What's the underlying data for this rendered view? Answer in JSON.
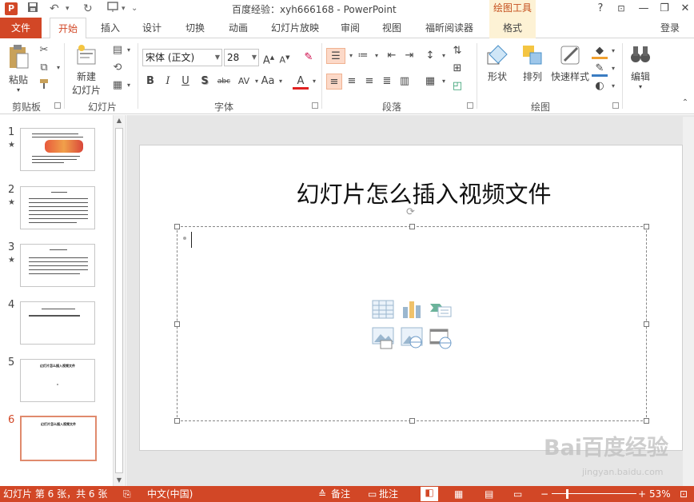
{
  "titlebar": {
    "app_icon": "P",
    "title": "百度经验：xyh666168 - PowerPoint",
    "context_tool": "绘图工具",
    "help": "?",
    "minimize": "—",
    "restore": "❐",
    "close": "✕"
  },
  "tabs": {
    "file": "文件",
    "items": [
      "开始",
      "插入",
      "设计",
      "切换",
      "动画",
      "幻灯片放映",
      "审阅",
      "视图",
      "福昕阅读器",
      "格式"
    ],
    "active": "开始",
    "login": "登录"
  },
  "ribbon": {
    "clipboard": {
      "label": "剪贴板",
      "paste": "粘贴"
    },
    "slides": {
      "label": "幻灯片",
      "new_slide_line1": "新建",
      "new_slide_line2": "幻灯片"
    },
    "font": {
      "label": "字体",
      "font_name": "宋体 (正文)",
      "font_size": "28",
      "bold": "B",
      "italic": "I",
      "underline": "U",
      "shadow": "S",
      "strike": "abc",
      "spacing": "AV",
      "case": "Aa",
      "color": "A"
    },
    "paragraph": {
      "label": "段落"
    },
    "drawing": {
      "label": "绘图",
      "shapes": "形状",
      "arrange": "排列",
      "quick_styles": "快速样式"
    },
    "editing": {
      "label": "编辑"
    }
  },
  "thumbnails": {
    "selected": 6,
    "items": [
      {
        "num": "1",
        "star": "★",
        "title": ""
      },
      {
        "num": "2",
        "star": "★",
        "title": ""
      },
      {
        "num": "3",
        "star": "★",
        "title": ""
      },
      {
        "num": "4",
        "star": "",
        "title": ""
      },
      {
        "num": "5",
        "star": "",
        "title": "幻灯片怎么插入视频文件"
      },
      {
        "num": "6",
        "star": "",
        "title": "幻灯片怎么插入视频文件"
      }
    ]
  },
  "slide": {
    "title": "幻灯片怎么插入视频文件",
    "placeholder_icons": [
      "table-icon",
      "chart-icon",
      "smartart-icon",
      "picture-icon",
      "online-picture-icon",
      "video-icon"
    ]
  },
  "statusbar": {
    "slide_info": "幻灯片 第 6 张，共 6 张",
    "language": "中文(中国)",
    "notes": "备注",
    "comments": "批注",
    "zoom": "53%",
    "zoom_minus": "−",
    "zoom_plus": "+"
  },
  "colors": {
    "accent": "#d24726",
    "context_tab_bg": "#fdf2d5"
  },
  "watermark": {
    "brand": "Bai百度经验",
    "url": "jingyan.baidu.com"
  }
}
